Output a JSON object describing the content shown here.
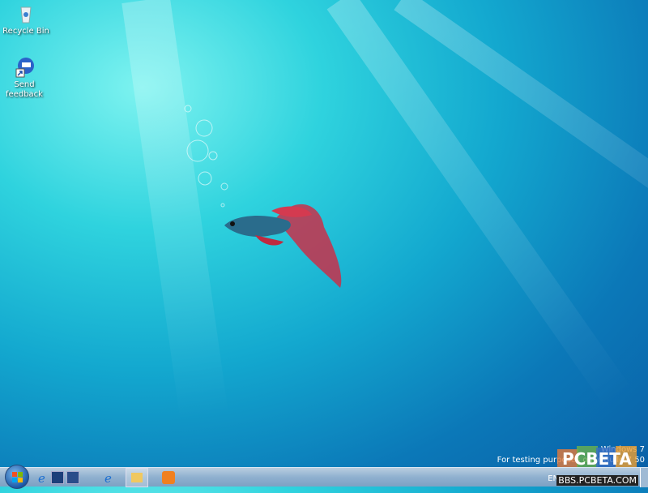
{
  "desktop": {
    "icons": [
      {
        "label": "Recycle Bin"
      },
      {
        "label": "Send feedback"
      }
    ]
  },
  "watermark": {
    "os": "Windows 7",
    "build_text": "For testing purposes only. Build 7",
    "build_tail": "50"
  },
  "overlay": {
    "logo": "PCBETA",
    "site": "BBS.PCBETA.COM"
  },
  "tray": {
    "language": "EN"
  },
  "colors": {
    "taskbar": "#8fb0cf",
    "accent": "#1c5aa8"
  }
}
